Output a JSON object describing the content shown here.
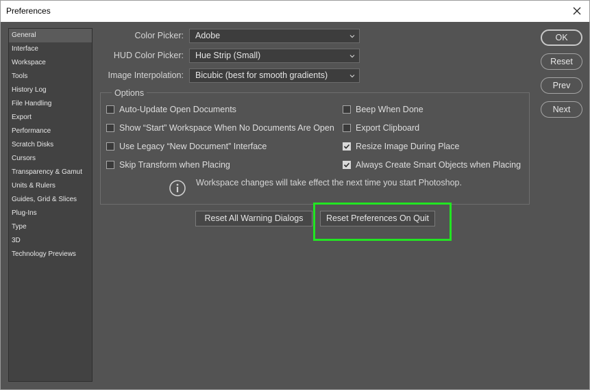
{
  "window": {
    "title": "Preferences"
  },
  "sidebar": {
    "items": [
      {
        "label": "General",
        "selected": true
      },
      {
        "label": "Interface"
      },
      {
        "label": "Workspace"
      },
      {
        "label": "Tools"
      },
      {
        "label": "History Log"
      },
      {
        "label": "File Handling"
      },
      {
        "label": "Export"
      },
      {
        "label": "Performance"
      },
      {
        "label": "Scratch Disks"
      },
      {
        "label": "Cursors"
      },
      {
        "label": "Transparency & Gamut"
      },
      {
        "label": "Units & Rulers"
      },
      {
        "label": "Guides, Grid & Slices"
      },
      {
        "label": "Plug-Ins"
      },
      {
        "label": "Type"
      },
      {
        "label": "3D"
      },
      {
        "label": "Technology Previews"
      }
    ]
  },
  "fields": {
    "color_picker": {
      "label": "Color Picker:",
      "value": "Adobe"
    },
    "hud_color_picker": {
      "label": "HUD Color Picker:",
      "value": "Hue Strip (Small)"
    },
    "image_interpolation": {
      "label": "Image Interpolation:",
      "value": "Bicubic (best for smooth gradients)"
    }
  },
  "options": {
    "title": "Options",
    "left": [
      {
        "label": "Auto-Update Open Documents",
        "checked": false
      },
      {
        "label": "Show “Start” Workspace When No Documents Are Open",
        "checked": false
      },
      {
        "label": "Use Legacy “New Document” Interface",
        "checked": false
      },
      {
        "label": "Skip Transform when Placing",
        "checked": false
      }
    ],
    "right": [
      {
        "label": "Beep When Done",
        "checked": false
      },
      {
        "label": "Export Clipboard",
        "checked": false
      },
      {
        "label": "Resize Image During Place",
        "checked": true
      },
      {
        "label": "Always Create Smart Objects when Placing",
        "checked": true
      }
    ],
    "info": "Workspace changes will take effect the next time you start Photoshop."
  },
  "buttons": {
    "reset_warning_dialogs": "Reset All Warning Dialogs",
    "reset_prefs_on_quit": "Reset Preferences On Quit",
    "ok": "OK",
    "reset": "Reset",
    "prev": "Prev",
    "next": "Next"
  },
  "colors": {
    "panel_bg": "#535353",
    "sidebar_bg": "#424242",
    "highlight": "#22e522"
  }
}
